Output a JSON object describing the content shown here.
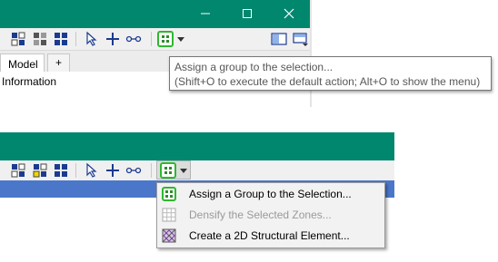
{
  "window_top": {
    "tab_model": "Model",
    "tab_add": "+",
    "info_label": "Information",
    "tooltip": {
      "line1": "Assign a group to the selection...",
      "line2": "(Shift+O to execute the default action; Alt+O to show the menu)"
    }
  },
  "dropdown_menu": {
    "items": [
      {
        "label": "Assign a Group to the Selection...",
        "icon": "group-assign-icon",
        "enabled": true
      },
      {
        "label": "Densify the Selected Zones...",
        "icon": "densify-grid-icon",
        "enabled": false
      },
      {
        "label": "Create a 2D Structural Element...",
        "icon": "structural-element-icon",
        "enabled": true
      }
    ]
  },
  "colors": {
    "titlebar": "#00876e",
    "toolbar": "#f0f0f0",
    "selection_bar": "#4a77c9",
    "group_button_border": "#2eb82e"
  }
}
